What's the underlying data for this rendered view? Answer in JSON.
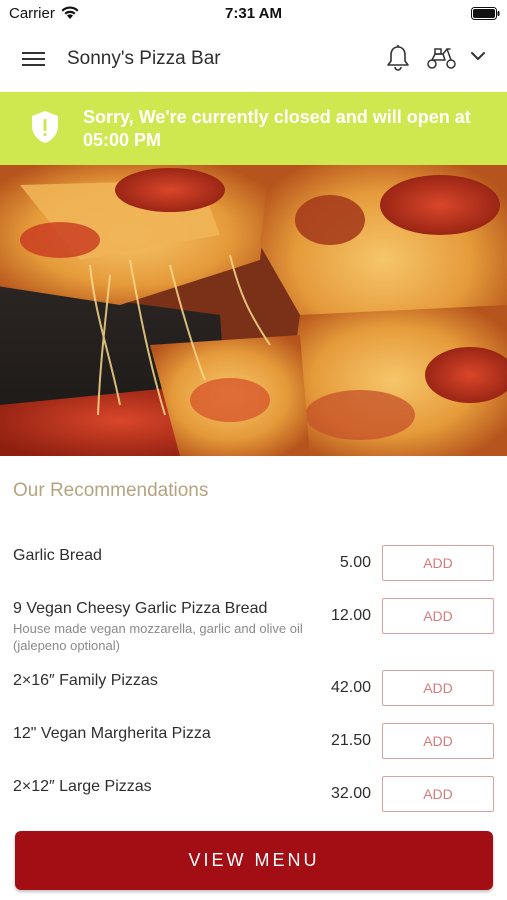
{
  "status_bar": {
    "carrier": "Carrier",
    "time": "7:31 AM"
  },
  "nav": {
    "title": "Sonny's Pizza Bar",
    "icons": [
      "hamburger-menu-icon",
      "bell-icon",
      "scooter-icon",
      "chevron-down-icon"
    ]
  },
  "banner": {
    "message": "Sorry, We're currently closed and will open at 05:00 PM",
    "color": "#cfe84f",
    "icon": "shield-alert-icon"
  },
  "hero": {
    "alt": "pizza"
  },
  "recommendations": {
    "title": "Our Recommendations",
    "items": [
      {
        "name": "Garlic Bread",
        "description": "",
        "price": "5.00",
        "button": "ADD"
      },
      {
        "name": "9 Vegan Cheesy Garlic Pizza Bread",
        "description": "House made vegan mozzarella, garlic and olive oil (jalepeno optional)",
        "price": "12.00",
        "button": "ADD"
      },
      {
        "name": "2×16″ Family Pizzas",
        "description": "",
        "price": "42.00",
        "button": "ADD"
      },
      {
        "name": "12\" Vegan Margherita Pizza",
        "description": "",
        "price": "21.50",
        "button": "ADD"
      },
      {
        "name": "2×12″ Large Pizzas",
        "description": "",
        "price": "32.00",
        "button": "ADD"
      }
    ]
  },
  "footer": {
    "view_menu_label": "VIEW MENU",
    "accent": "#a30d14"
  }
}
